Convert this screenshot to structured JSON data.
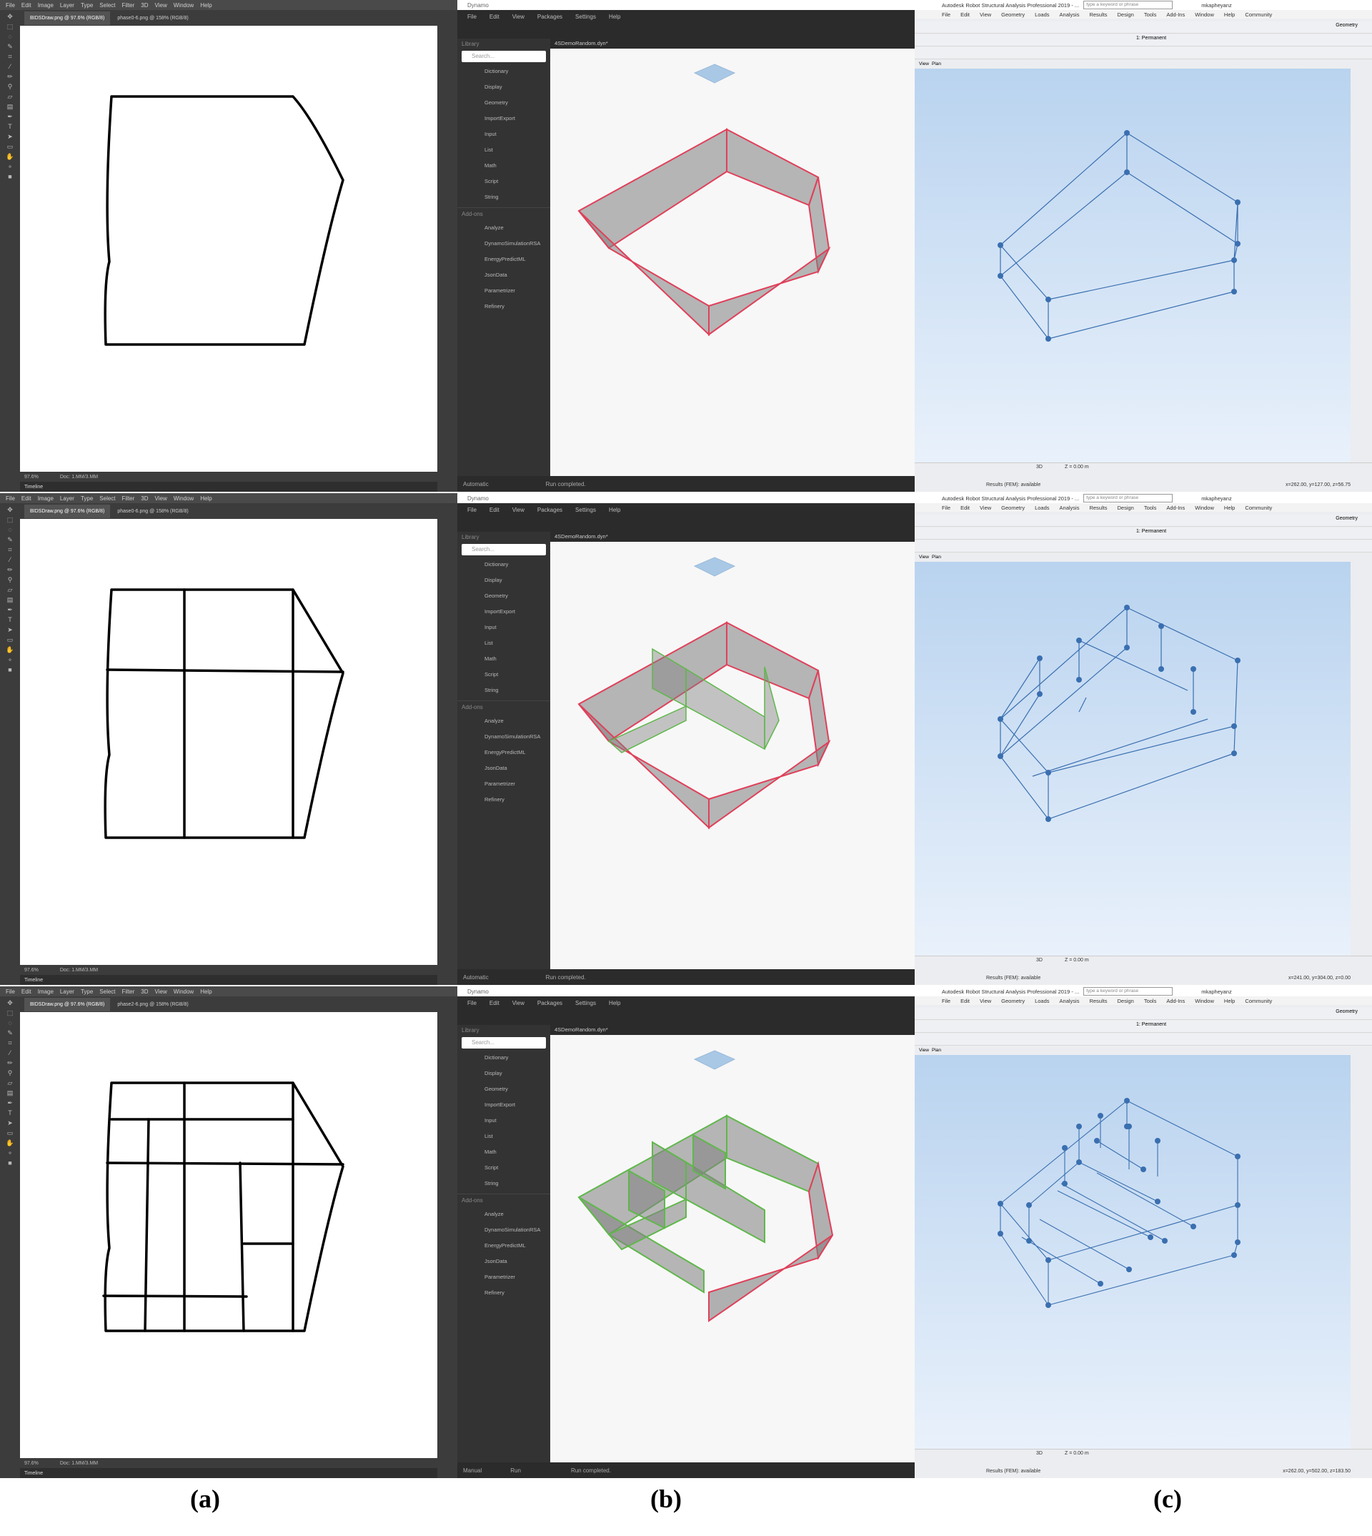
{
  "captions": [
    "(a)",
    "(b)",
    "(c)"
  ],
  "photoshop": {
    "menu": [
      "File",
      "Edit",
      "Image",
      "Layer",
      "Type",
      "Select",
      "Filter",
      "3D",
      "View",
      "Window",
      "Help"
    ],
    "tabs": [
      {
        "active": "BIDSDraw.png @ 97.6% (RGB/8)",
        "other": "phase0-6.png @ 158% (RGB/8)"
      },
      {
        "active": "BIDSDraw.png @ 97.6% (RGB/8)",
        "other": "phase0-6.png @ 158% (RGB/8)"
      },
      {
        "active": "BIDSDraw.png @ 97.6% (RGB/8)",
        "other": "phase2-6.png @ 158% (RGB/8)"
      }
    ],
    "zoom": "97.6%",
    "doc": "Doc: 1.MM/3.MM",
    "timeline": "Timeline"
  },
  "dynamo": {
    "title": "Dynamo",
    "menu": [
      "File",
      "Edit",
      "View",
      "Packages",
      "Settings",
      "Help"
    ],
    "library_label": "Library",
    "search_placeholder": "Search...",
    "library_items": [
      "Dictionary",
      "Display",
      "Geometry",
      "ImportExport",
      "Input",
      "List",
      "Math",
      "Script",
      "String"
    ],
    "addons_label": "Add-ons",
    "addon_items": [
      "Analyze",
      "DynamoSimulationRSA",
      "EnergyPredictML",
      "JsonData",
      "Parametrizer",
      "Refinery"
    ],
    "file_tab": "4SDemoRandom.dyn*",
    "run_modes": [
      "Automatic",
      "Automatic",
      "Manual"
    ],
    "run_button": "Run",
    "status": "Run completed."
  },
  "robot": {
    "title": "Autodesk Robot Structural Analysis Professional 2019 - ...",
    "search_placeholder": "type a keyword or phrase",
    "user": "mkapheyanz",
    "menu": [
      "File",
      "Edit",
      "View",
      "Geometry",
      "Loads",
      "Analysis",
      "Results",
      "Design",
      "Tools",
      "Add-Ins",
      "Window",
      "Help",
      "Community"
    ],
    "layout_dropdown": "Geometry",
    "load_case": "1: Permanent",
    "view_tabs": [
      "View",
      "Plan"
    ],
    "view_mode": "3D",
    "level": "Z = 0.00 m",
    "results_status": "Results (FEM): available",
    "coords": [
      "x=262.00, y=127.00, z=56.75",
      "x=241.00, y=304.00, z=0.00",
      "x=262.00, y=502.00, z=183.50"
    ]
  },
  "colors": {
    "ps_bg": "#535353",
    "dynamo_bg": "#2b2b2b",
    "shell_fill": "#808080",
    "edge_red": "#e0405a",
    "edge_green": "#5fb84a",
    "robot_line": "#3a6fb0",
    "robot_node": "#3a6fb0"
  }
}
